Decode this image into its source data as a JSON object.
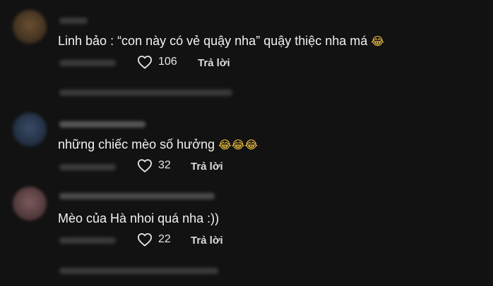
{
  "comments": [
    {
      "text": "Linh bảo : “con này có vẻ quậy nha” quậy thiệc nha má ",
      "emoji": "😂",
      "likes": "106",
      "reply_label": "Trả lời",
      "avatar_color": "#4a3a2a"
    },
    {
      "text": "những chiếc mèo số hưởng ",
      "emoji": "😂😂😂",
      "likes": "32",
      "reply_label": "Trả lời",
      "avatar_color": "#243042"
    },
    {
      "text": "Mèo của Hà nhoi quá nha :))",
      "emoji": "",
      "likes": "22",
      "reply_label": "Trả lời",
      "avatar_color": "#4a3536"
    }
  ],
  "icons": {
    "like": "heart-outline-icon"
  },
  "colors": {
    "background": "#121212",
    "text": "#f2f2f2",
    "muted": "#3a3a3a"
  }
}
